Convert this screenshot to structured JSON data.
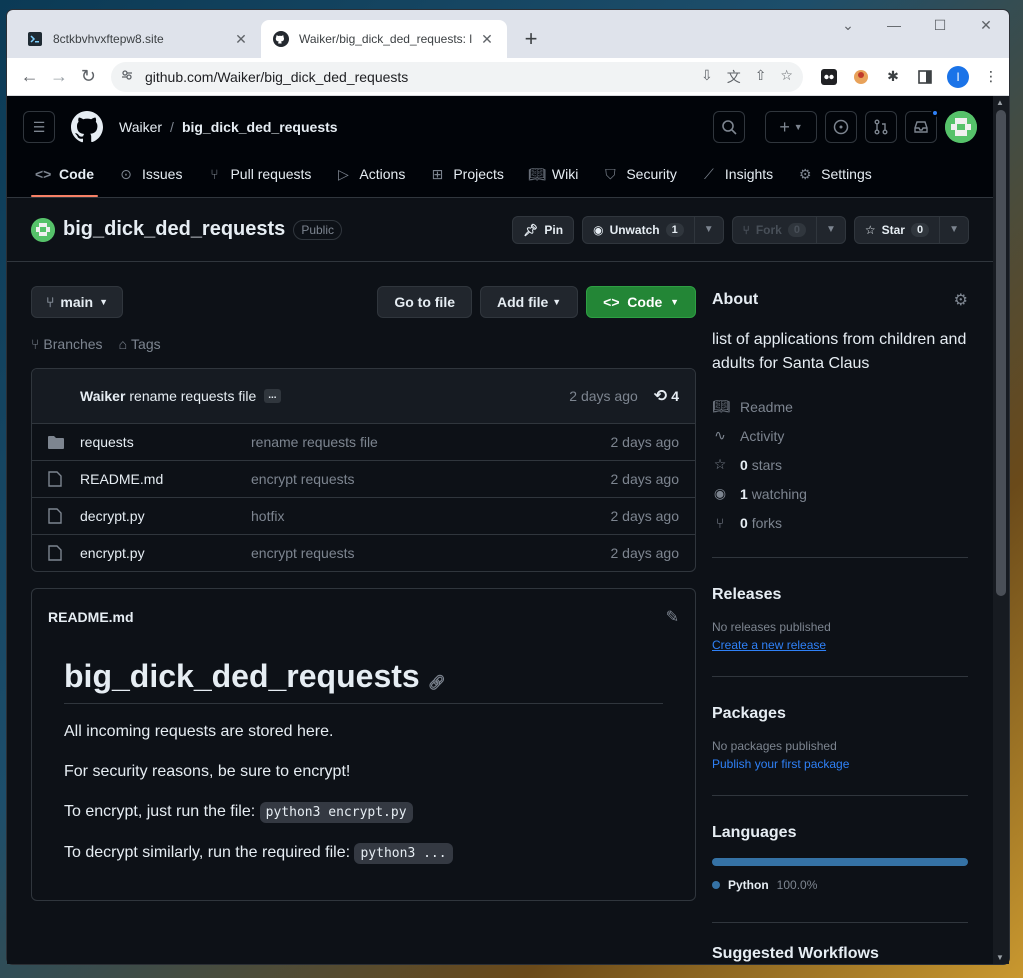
{
  "browser": {
    "tabs": [
      {
        "title": "8ctkbvhvxftepw8.site",
        "active": false
      },
      {
        "title": "Waiker/big_dick_ded_requests: l",
        "active": true
      }
    ],
    "url": "github.com/Waiker/big_dick_ded_requests",
    "profile_initial": "I"
  },
  "header": {
    "owner": "Waiker",
    "separator": "/",
    "repo": "big_dick_ded_requests"
  },
  "reponav": [
    {
      "label": "Code",
      "icon": "code-icon"
    },
    {
      "label": "Issues",
      "icon": "issue-icon"
    },
    {
      "label": "Pull requests",
      "icon": "pull-request-icon"
    },
    {
      "label": "Actions",
      "icon": "play-icon"
    },
    {
      "label": "Projects",
      "icon": "table-icon"
    },
    {
      "label": "Wiki",
      "icon": "book-icon"
    },
    {
      "label": "Security",
      "icon": "shield-icon"
    },
    {
      "label": "Insights",
      "icon": "graph-icon"
    },
    {
      "label": "Settings",
      "icon": "gear-icon"
    }
  ],
  "repo": {
    "name": "big_dick_ded_requests",
    "visibility": "Public",
    "pin_label": "Pin",
    "unwatch_label": "Unwatch",
    "watch_count": "1",
    "fork_label": "Fork",
    "fork_count": "0",
    "star_label": "Star",
    "star_count": "0"
  },
  "toolbar": {
    "branch": "main",
    "goto_file": "Go to file",
    "add_file": "Add file",
    "code": "Code",
    "branches": "Branches",
    "tags": "Tags"
  },
  "commit": {
    "author": "Waiker",
    "message": "rename requests file",
    "ellipsis": "...",
    "when": "2 days ago",
    "count": "4"
  },
  "files": [
    {
      "name": "requests",
      "type": "folder",
      "message": "rename requests file",
      "when": "2 days ago"
    },
    {
      "name": "README.md",
      "type": "file",
      "message": "encrypt requests",
      "when": "2 days ago"
    },
    {
      "name": "decrypt.py",
      "type": "file",
      "message": "hotfix",
      "when": "2 days ago"
    },
    {
      "name": "encrypt.py",
      "type": "file",
      "message": "encrypt requests",
      "when": "2 days ago"
    }
  ],
  "readme": {
    "filename": "README.md",
    "heading": "big_dick_ded_requests",
    "p1": "All incoming requests are stored here.",
    "p2": "For security reasons, be sure to encrypt!",
    "p3_text": "To encrypt, just run the file: ",
    "p3_code": "python3 encrypt.py",
    "p4_text": "To decrypt similarly, run the required file: ",
    "p4_code": "python3 ..."
  },
  "about": {
    "title": "About",
    "description": "list of applications from children and adults for Santa Claus",
    "readme": "Readme",
    "activity": "Activity",
    "stars_count": "0",
    "stars_label": "stars",
    "watching_count": "1",
    "watching_label": "watching",
    "forks_count": "0",
    "forks_label": "forks"
  },
  "releases": {
    "title": "Releases",
    "empty": "No releases published",
    "link": "Create a new release"
  },
  "packages": {
    "title": "Packages",
    "empty": "No packages published",
    "link": "Publish your first package"
  },
  "languages": {
    "title": "Languages",
    "name": "Python",
    "percent": "100.0%",
    "color": "#3572a5"
  },
  "suggested_heading": "Suggested Workflows"
}
